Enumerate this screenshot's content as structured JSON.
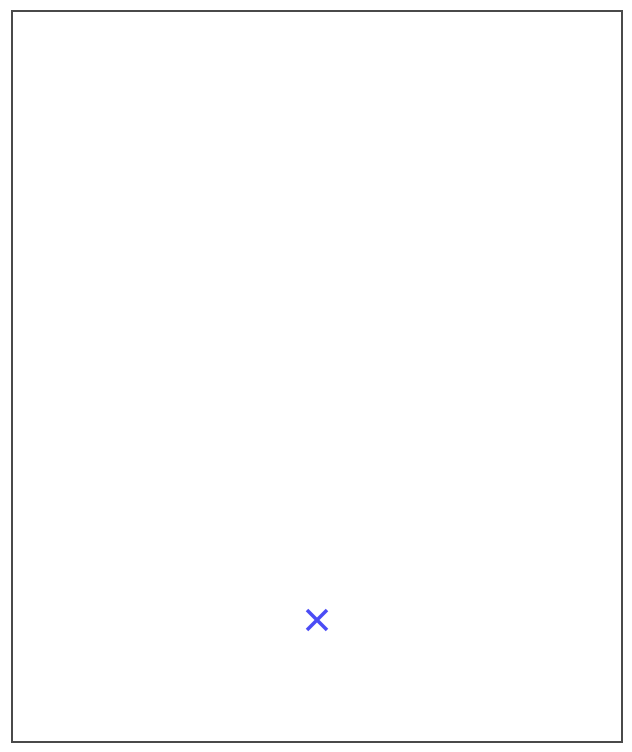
{
  "dialog": {
    "close_icon": "close-icon",
    "close_icon_color": "#4b4cf5",
    "border_color": "#4a4a4a",
    "background": "#ffffff"
  }
}
